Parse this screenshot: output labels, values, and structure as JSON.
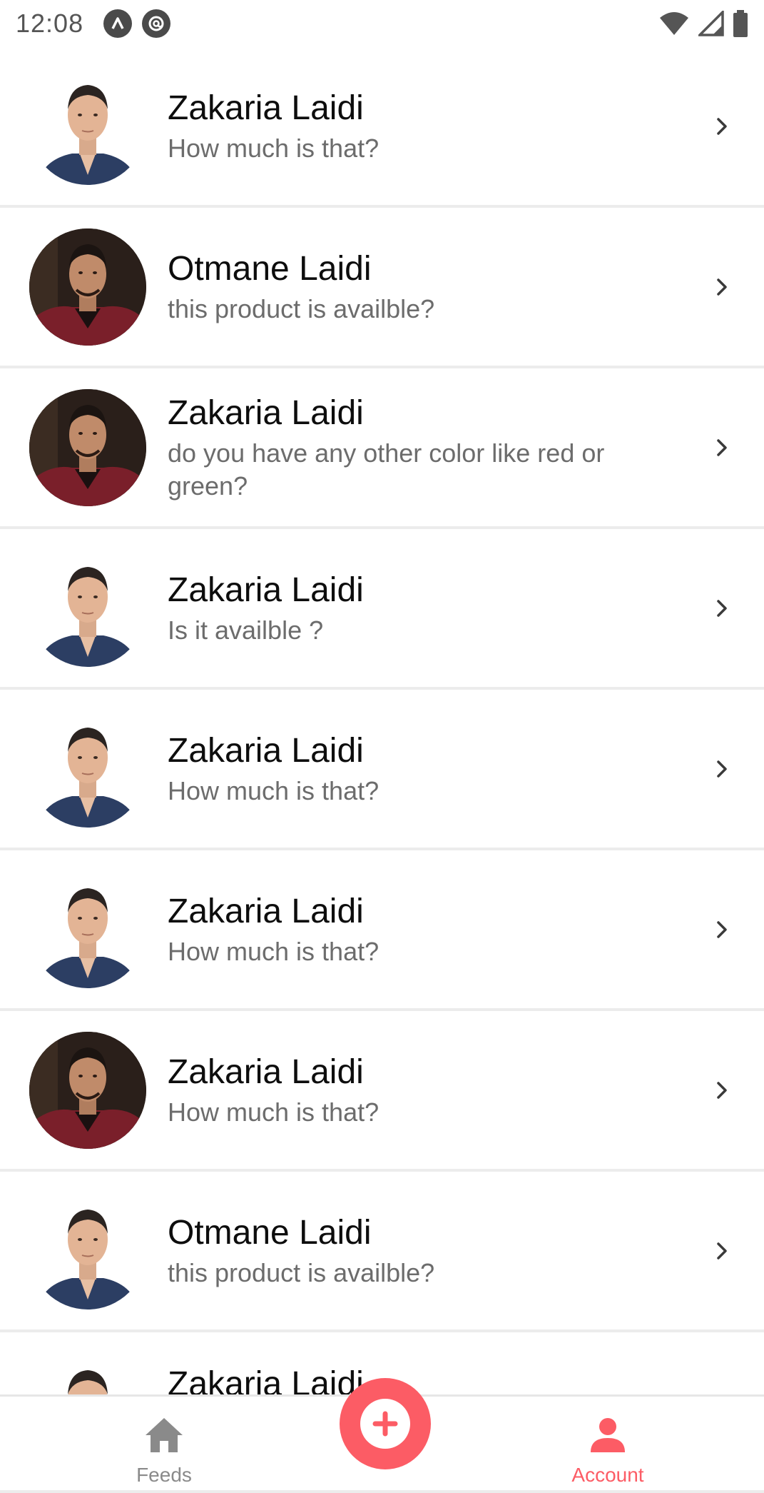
{
  "status_bar": {
    "time": "12:08"
  },
  "messages": [
    {
      "title": "Zakaria Laidi",
      "subtitle": "How much is that?",
      "avatar": "light"
    },
    {
      "title": "Otmane Laidi",
      "subtitle": "this product is availble?",
      "avatar": "dark"
    },
    {
      "title": "Zakaria Laidi",
      "subtitle": "do you have any other color like red or green?",
      "avatar": "dark"
    },
    {
      "title": "Zakaria Laidi",
      "subtitle": "Is it availble ?",
      "avatar": "light"
    },
    {
      "title": "Zakaria Laidi",
      "subtitle": "How much is that?",
      "avatar": "light"
    },
    {
      "title": "Zakaria Laidi",
      "subtitle": "How much is that?",
      "avatar": "light"
    },
    {
      "title": "Zakaria Laidi",
      "subtitle": "How much is that?",
      "avatar": "dark"
    },
    {
      "title": "Otmane Laidi",
      "subtitle": "this product is availble?",
      "avatar": "light"
    },
    {
      "title": "Zakaria Laidi",
      "subtitle": "",
      "avatar": "light"
    }
  ],
  "tabs": {
    "feeds": {
      "label": "Feeds",
      "icon": "home-icon"
    },
    "add": {
      "icon": "plus-icon"
    },
    "account": {
      "label": "Account",
      "icon": "person-icon",
      "active": true
    }
  },
  "colors": {
    "accent": "#fc5c65",
    "inactive": "#8a8a8a"
  }
}
